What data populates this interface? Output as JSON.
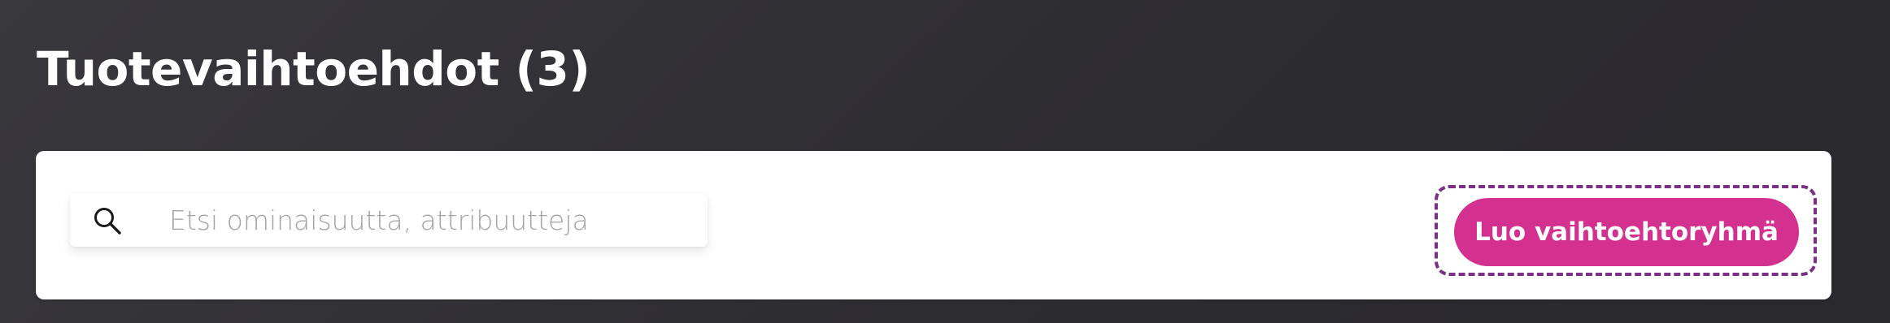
{
  "header": {
    "title": "Tuotevaihtoehdot (3)"
  },
  "toolbar": {
    "search": {
      "placeholder": "Etsi ominaisuutta, attribuutteja",
      "value": "",
      "icon": "search-icon"
    },
    "create_button_label": "Luo vaihtoehtoryhmä"
  },
  "colors": {
    "accent": "#d4308f",
    "highlight_border": "#7b2f86",
    "background": "#2d2c31",
    "panel": "#ffffff"
  }
}
